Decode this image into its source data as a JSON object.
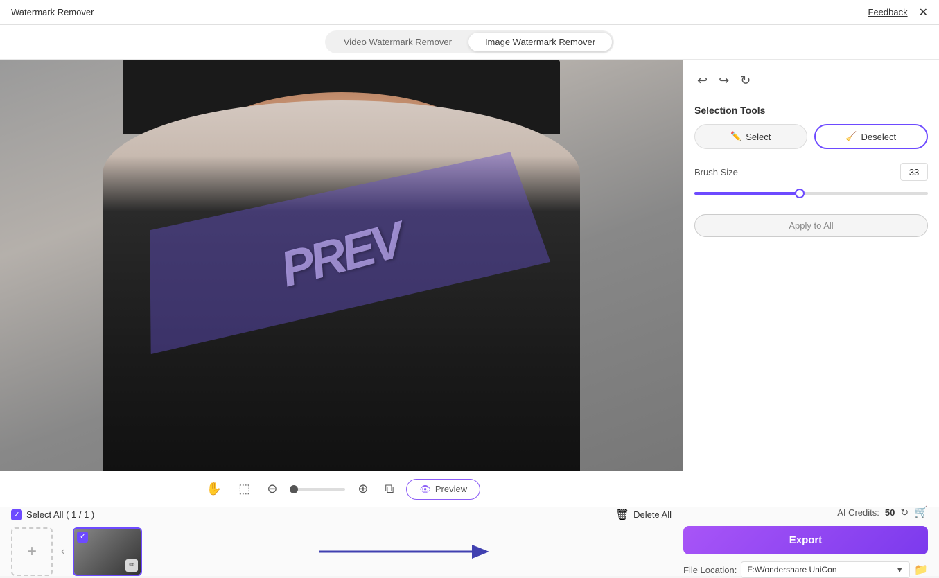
{
  "titleBar": {
    "title": "Watermark Remover",
    "feedback": "Feedback",
    "close": "✕"
  },
  "tabs": {
    "video": "Video Watermark Remover",
    "image": "Image Watermark Remover",
    "activeTab": "image"
  },
  "toolbar": {
    "zoomOut": "−",
    "zoomIn": "+",
    "preview": "Preview"
  },
  "rightPanel": {
    "selectionTools": "Selection Tools",
    "selectBtn": "Select",
    "deselectBtn": "Deselect",
    "brushSize": "Brush Size",
    "brushValue": "33",
    "applyToAll": "Apply to All"
  },
  "bottomPanel": {
    "selectAll": "Select All ( 1 / 1 )",
    "deleteAll": "Delete All",
    "aiCredits": "AI Credits:",
    "creditsCount": "50",
    "export": "Export",
    "fileLocation": "File Location:",
    "filePath": "F:\\Wondershare UniCon"
  }
}
